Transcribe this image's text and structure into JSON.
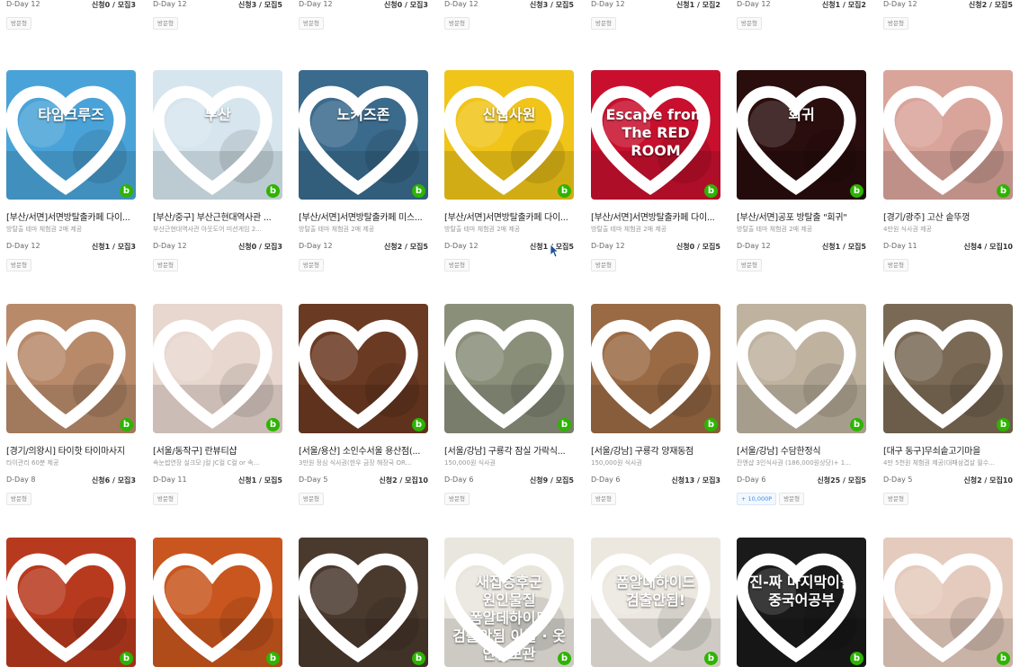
{
  "top_row": [
    {
      "dday": "D-Day 12",
      "count": "신청0 / 모집3",
      "tags": [
        "방문형"
      ]
    },
    {
      "dday": "D-Day 12",
      "count": "신청3 / 모집5",
      "tags": [
        "방문형"
      ]
    },
    {
      "dday": "D-Day 12",
      "count": "신청0 / 모집3",
      "tags": [
        "방문형"
      ]
    },
    {
      "dday": "D-Day 12",
      "count": "신청3 / 모집5",
      "tags": [
        "방문형"
      ]
    },
    {
      "dday": "D-Day 12",
      "count": "신청1 / 모집2",
      "tags": [
        "방문형"
      ]
    },
    {
      "dday": "D-Day 12",
      "count": "신청1 / 모집2",
      "tags": [
        "방문형"
      ]
    },
    {
      "dday": "D-Day 12",
      "count": "신청2 / 모집5",
      "tags": [
        "방문형"
      ]
    }
  ],
  "row1": [
    {
      "thumb_text": "타임크루즈",
      "thumb_color": "#4aa3d8",
      "title": "[부산/서면]서면방탈출카페 다이...",
      "sub": "방탈출 테마 체험권 2매 제공",
      "dday": "D-Day 12",
      "count": "신청1 / 모집3",
      "tags": [
        "방문형"
      ]
    },
    {
      "thumb_text": "부산",
      "thumb_color": "#d7e6ee",
      "title": "[부산/중구] 부산근현대역사관 ...",
      "sub": "부산근현대역사관 아웃도어 미션게임 2...",
      "dday": "D-Day 12",
      "count": "신청0 / 모집3",
      "tags": [
        "방문형"
      ]
    },
    {
      "thumb_text": "노키즈존",
      "thumb_color": "#3a6a8c",
      "title": "[부산/서면]서면방탈출카페 미스...",
      "sub": "방탈출 테마 체험권 2매 제공",
      "dday": "D-Day 12",
      "count": "신청2 / 모집5",
      "tags": [
        "방문형"
      ]
    },
    {
      "thumb_text": "신입사원",
      "thumb_color": "#f0c419",
      "title": "[부산/서면]서면방탈출카페 다이...",
      "sub": "방탈출 테마 체험권 2매 제공",
      "dday": "D-Day 12",
      "count": "신청1 / 모집5",
      "tags": [
        "방문형"
      ]
    },
    {
      "thumb_text": "Escape from The RED ROOM",
      "thumb_color": "#c8102e",
      "title": "[부산/서면]서면방탈출카페 다이...",
      "sub": "방탈출 테마 체험권 2매 제공",
      "dday": "D-Day 12",
      "count": "신청0 / 모집5",
      "tags": [
        "방문형"
      ]
    },
    {
      "thumb_text": "회귀",
      "thumb_color": "#2a0d0d",
      "title": "[부산/서면]공포 방탈출 \"회귀\"",
      "sub": "방탈출 테마 체험권 2매 제공",
      "dday": "D-Day 12",
      "count": "신청1 / 모집5",
      "tags": [
        "방문형"
      ]
    },
    {
      "thumb_text": "",
      "thumb_color": "#d9a49a",
      "title": "[경기/광주] 고산 솥뚜껑",
      "sub": "4만원 식사권 제공",
      "dday": "D-Day 11",
      "count": "신청4 / 모집10",
      "tags": [
        "방문형"
      ]
    }
  ],
  "row2": [
    {
      "thumb_text": "",
      "thumb_color": "#b88a6a",
      "title": "[경기/의왕시] 타이핫 타이마사지",
      "sub": "타이관리 60분 제공",
      "dday": "D-Day 8",
      "count": "신청6 / 모집3",
      "tags": [
        "방문형"
      ]
    },
    {
      "thumb_text": "",
      "thumb_color": "#e8d7cf",
      "title": "[서울/동작구] 란뷰티샵",
      "sub": "속눈썹연장 실크모 J컬 JC컬 C컬 or 속...",
      "dday": "D-Day 11",
      "count": "신청1 / 모집5",
      "tags": [
        "방문형"
      ]
    },
    {
      "thumb_text": "",
      "thumb_color": "#6b3a22",
      "title": "[서울/용산] 소인수서울 용산점(...",
      "sub": "3만원 정심 식사권(한우 금장 해장국 OR...",
      "dday": "D-Day 5",
      "count": "신청2 / 모집10",
      "tags": [
        "방문형"
      ]
    },
    {
      "thumb_text": "",
      "thumb_color": "#8a8f7a",
      "title": "[서울/강남] 구룡각 잠실 가락식...",
      "sub": "150,000원 식사권",
      "dday": "D-Day 6",
      "count": "신청9 / 모집5",
      "tags": [
        "방문형"
      ]
    },
    {
      "thumb_text": "",
      "thumb_color": "#9a6a45",
      "title": "[서울/강남] 구룡각 양재동점",
      "sub": "150,000원 식사권",
      "dday": "D-Day 6",
      "count": "신청13 / 모집3",
      "tags": [
        "방문형"
      ]
    },
    {
      "thumb_text": "",
      "thumb_color": "#bfb3a0",
      "title": "[서울/강남] 수담한정식",
      "sub": "잔앤샵 3인식사권 (186,000원상당)+ 1...",
      "dday": "D-Day 6",
      "count": "신청25 / 모집5",
      "tags": [
        "+ 10,000P",
        "방문형"
      ]
    },
    {
      "thumb_text": "",
      "thumb_color": "#7a6a55",
      "title": "[대구 동구]무쇠솥고기마을",
      "sub": "4만 5천원 체험권 제공(대패삼겹살 필수...",
      "dday": "D-Day 5",
      "count": "신청2 / 모집10",
      "tags": [
        "방문형"
      ]
    }
  ],
  "row3": [
    {
      "thumb_text": "",
      "thumb_color": "#b83a1e"
    },
    {
      "thumb_text": "",
      "thumb_color": "#c9561e"
    },
    {
      "thumb_text": "",
      "thumb_color": "#4a3a2e"
    },
    {
      "thumb_text": "새집증후군 원인물질 폼알데하이드 검출안됨 이불 · 옷 안심보관",
      "thumb_color": "#e9e6de"
    },
    {
      "thumb_text": "폼알데하이드 검출안됨!",
      "thumb_color": "#ece8e0"
    },
    {
      "thumb_text": "진-짜 마지막이될 중국어공부",
      "thumb_color": "#1a1a1a"
    },
    {
      "thumb_text": "",
      "thumb_color": "#e5cbbd"
    }
  ],
  "badge_letter": "b"
}
